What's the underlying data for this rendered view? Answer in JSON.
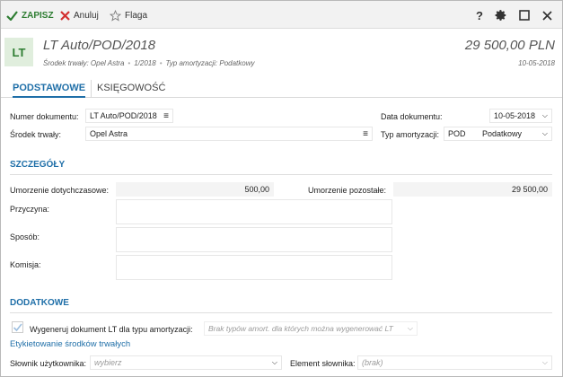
{
  "toolbar": {
    "save_label": "ZAPISZ",
    "cancel_label": "Anuluj",
    "flag_label": "Flaga"
  },
  "header": {
    "badge": "LT",
    "title": "LT Auto/POD/2018",
    "subtitle_asset": "Środek trwały: Opel Astra",
    "subtitle_number": "1/2018",
    "subtitle_depr": "Typ amortyzacji: Podatkowy",
    "amount": "29 500,00 PLN",
    "date": "10-05-2018"
  },
  "tabs": [
    {
      "label": "PODSTAWOWE"
    },
    {
      "label": "KSIĘGOWOŚĆ"
    }
  ],
  "form": {
    "doc_number_label": "Numer dokumentu:",
    "doc_number_value": "LT Auto/POD/2018",
    "asset_label": "Środek trwały:",
    "asset_value": "Opel Astra",
    "doc_date_label": "Data dokumentu:",
    "doc_date_value": "10-05-2018",
    "depr_type_label": "Typ amortyzacji:",
    "depr_type_code": "POD",
    "depr_type_value": "Podatkowy"
  },
  "details": {
    "section_title": "SZCZEGÓŁY",
    "depr_so_far_label": "Umorzenie dotychczasowe:",
    "depr_so_far_value": "500,00",
    "depr_remaining_label": "Umorzenie pozostałe:",
    "depr_remaining_value": "29 500,00",
    "reason_label": "Przyczyna:",
    "method_label": "Sposób:",
    "committee_label": "Komisja:"
  },
  "additional": {
    "section_title": "DODATKOWE",
    "generate_label": "Wygeneruj dokument LT dla typu amortyzacji:",
    "generate_placeholder": "Brak typów amort. dla których można wygenerować LT",
    "labeling_link": "Etykietowanie środków trwałych",
    "dict_label": "Słownik użytkownika:",
    "dict_placeholder": "wybierz",
    "dict_element_label": "Element słownika:",
    "dict_element_placeholder": "(brak)"
  },
  "colors": {
    "accent": "#1f6fa8",
    "save_green": "#2e7d32",
    "cancel_red": "#d32f2f",
    "badge_bg": "#e0eedd"
  }
}
